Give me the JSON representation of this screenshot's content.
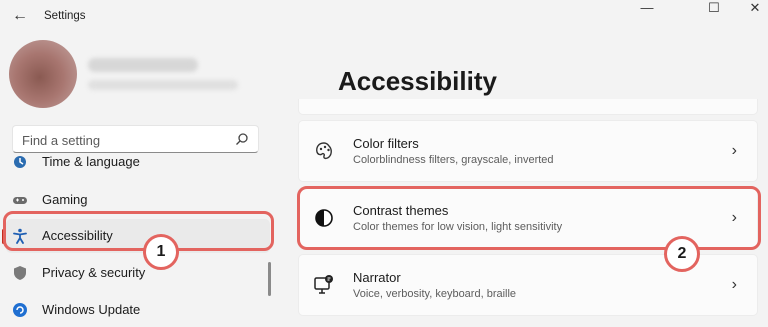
{
  "window": {
    "title": "Settings",
    "back_icon": "back-arrow-icon",
    "controls": [
      {
        "name": "minimize-button",
        "glyph": "—"
      },
      {
        "name": "maximize-button",
        "glyph": "☐"
      },
      {
        "name": "close-button",
        "glyph": "✕"
      }
    ]
  },
  "search": {
    "placeholder": "Find a setting",
    "icon": "search-icon"
  },
  "sidebar": {
    "items": [
      {
        "label": "Time & language",
        "icon": "time-language-icon"
      },
      {
        "label": "Gaming",
        "icon": "gaming-icon"
      },
      {
        "label": "Accessibility",
        "icon": "accessibility-icon",
        "active": true
      },
      {
        "label": "Privacy & security",
        "icon": "shield-icon"
      },
      {
        "label": "Windows Update",
        "icon": "windows-update-icon"
      }
    ]
  },
  "main": {
    "title": "Accessibility",
    "cards": [
      {
        "title": "Color filters",
        "subtitle": "Colorblindness filters, grayscale, inverted",
        "icon": "color-filters-icon"
      },
      {
        "title": "Contrast themes",
        "subtitle": "Color themes for low vision, light sensitivity",
        "icon": "contrast-icon"
      },
      {
        "title": "Narrator",
        "subtitle": "Voice, verbosity, keyboard, braille",
        "icon": "narrator-icon"
      }
    ]
  },
  "annotations": [
    {
      "number": "1",
      "target": "Accessibility"
    },
    {
      "number": "2",
      "target": "Contrast themes"
    }
  ],
  "colors": {
    "accent": "#c42b1c",
    "highlight": "#e3645f",
    "background": "#f3f3f3",
    "card": "#fbfbfb"
  }
}
